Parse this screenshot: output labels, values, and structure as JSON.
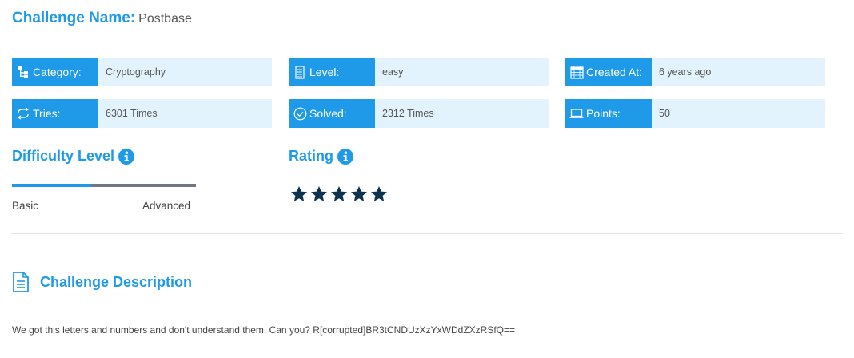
{
  "challenge": {
    "name_label": "Challenge Name:",
    "name_value": "Postbase"
  },
  "info": {
    "category": {
      "label": "Category:",
      "value": "Cryptography",
      "icon": "sitemap-icon"
    },
    "level": {
      "label": "Level:",
      "value": "easy",
      "icon": "level-icon"
    },
    "created": {
      "label": "Created At:",
      "value": "6 years ago",
      "icon": "calendar-icon"
    },
    "tries": {
      "label": "Tries:",
      "value": "6301 Times",
      "icon": "retry-icon"
    },
    "solved": {
      "label": "Solved:",
      "value": "2312 Times",
      "icon": "check-circle-icon"
    },
    "points": {
      "label": "Points:",
      "value": "50",
      "icon": "laptop-icon"
    }
  },
  "difficulty": {
    "title": "Difficulty Level",
    "min_label": "Basic",
    "max_label": "Advanced",
    "level_fraction": 0.43
  },
  "rating": {
    "title": "Rating",
    "stars": 5,
    "max_stars": 5
  },
  "description": {
    "title": "Challenge Description",
    "text": "We got this letters and numbers and don't understand them. Can you? R[corrupted]BR3tCNDUzXzYxWDdZXzRSfQ=="
  },
  "colors": {
    "accent": "#1e9ae8",
    "box_bg": "#e3f3fd",
    "star": "#0d3350",
    "bar_track": "#707780"
  }
}
